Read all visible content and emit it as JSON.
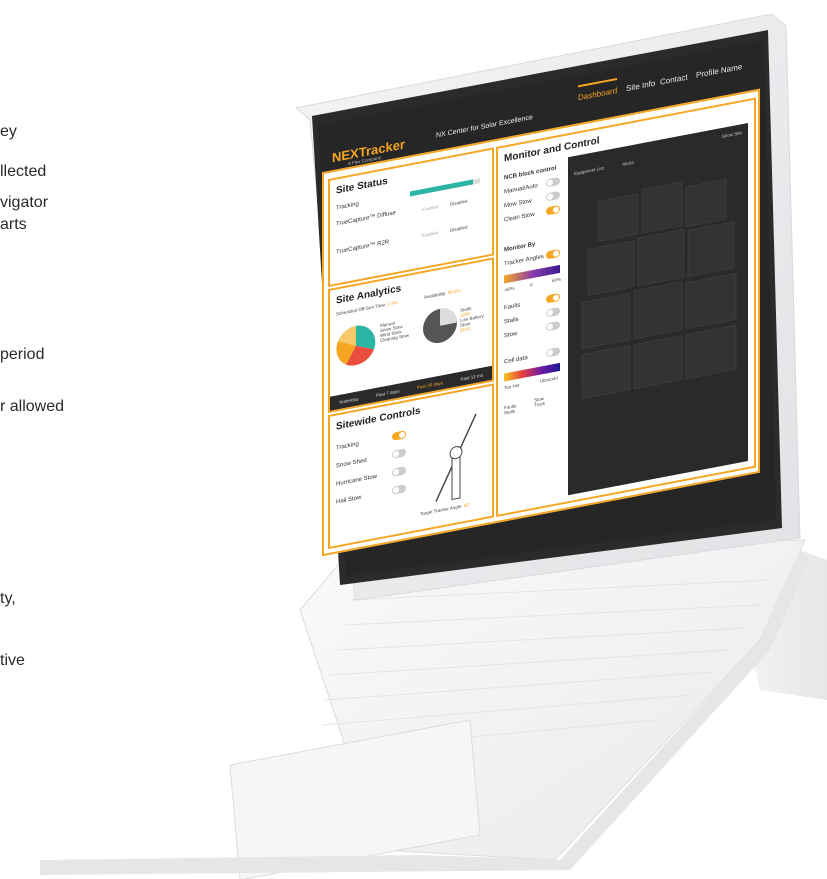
{
  "side_text": {
    "lines": [
      "ey",
      "llected",
      "vigator",
      "arts",
      "period",
      "r allowed",
      "ty,",
      "tive"
    ]
  },
  "header": {
    "logo": "NEXTracker",
    "logo_sub": "A Flex Company",
    "center_title": "NX Center for Solar Excellence",
    "nav": [
      "Dashboard",
      "Site Info",
      "Contact",
      "Profile Name"
    ]
  },
  "site_status": {
    "title": "Site Status",
    "tracking_label": "Tracking",
    "truecapture_diffuse": "TrueCapture™ Diffuse",
    "truecapture_row": "TrueCapture™ R2R",
    "enabled": "Enabled",
    "disabled": "Disabled",
    "tracking_progress": 0.9
  },
  "site_analytics": {
    "title": "Site Analytics",
    "scheduled": "Scheduled Off-Sun Time:",
    "scheduled_value": "2.3%",
    "availability": "Availability:",
    "availability_value": "99.9%",
    "legend": [
      "Manual",
      "Snow Stow",
      "Wind Stow",
      "Cleaning Stow"
    ],
    "legend_right": [
      "Stalls:",
      "1200",
      "Low Battery",
      "Stow:",
      "8100"
    ],
    "ranges": [
      "Yesterday",
      "Past 7 days",
      "Past 30 days",
      "Past 12 mo"
    ],
    "active_range": "Past 30 days"
  },
  "sitewide": {
    "title": "Sitewide Controls",
    "items": [
      "Tracking",
      "Snow Shed",
      "Hurricane Stow",
      "Hail Stow"
    ],
    "target": "Target Tracker Angle:",
    "target_value": "60°"
  },
  "monitor": {
    "title": "Monitor and Control",
    "ncb_label": "NCB block control",
    "controls": [
      "Manual/Auto",
      "Mow Stow",
      "Clean Stow"
    ],
    "monitor_by": "Monitor By",
    "tracker_angles": "Tracker Angles",
    "angle_min": "-60%",
    "angle_mid": "0",
    "angle_max": "60%",
    "faults": "Faults",
    "stalls": "Stalls",
    "stow": "Stow",
    "cell_data": "Cell data",
    "cell_min": "Too Hot",
    "cell_max": "Ultracold",
    "legend_left": [
      "Faults",
      "Stalls"
    ],
    "legend_right": [
      "Stow",
      "Track"
    ],
    "tabs": [
      "Equipment List",
      "Alerts"
    ],
    "show_all": "Show Site"
  },
  "colors": {
    "accent": "#f5a623",
    "dark": "#2a2a2a",
    "teal": "#2bb5a4"
  }
}
